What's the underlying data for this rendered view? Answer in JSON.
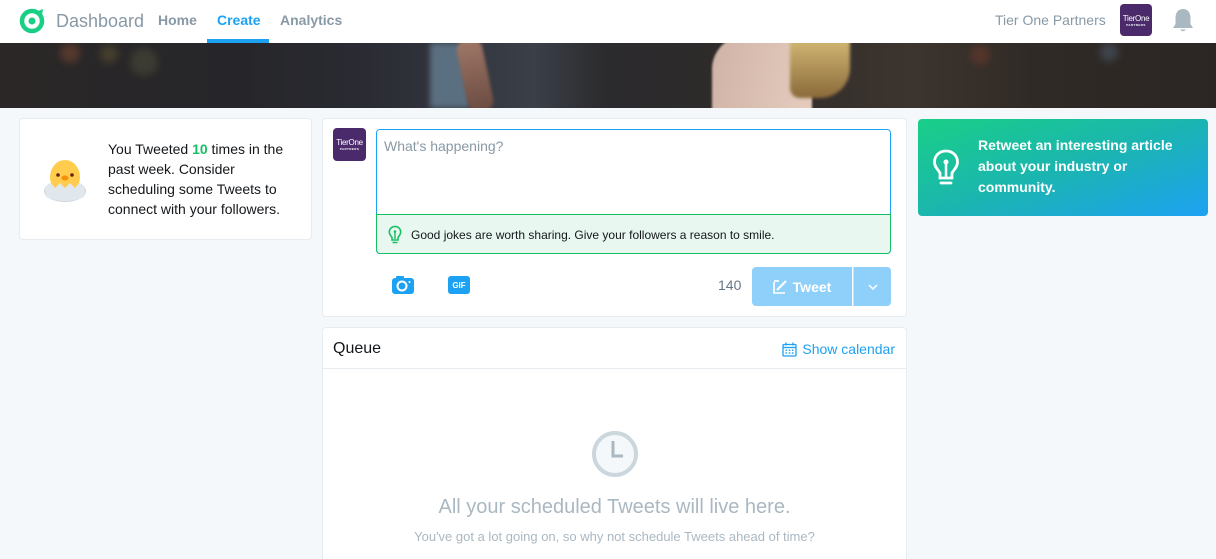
{
  "nav": {
    "brand": "Dashboard",
    "links": [
      {
        "label": "Home",
        "active": false
      },
      {
        "label": "Create",
        "active": true
      },
      {
        "label": "Analytics",
        "active": false
      }
    ],
    "account_name": "Tier One Partners",
    "avatar_text": "TierOne",
    "avatar_subtext": "PARTNERS",
    "icons": {
      "logo": "dashboard-logo-icon",
      "notifications": "bell-icon"
    }
  },
  "stats": {
    "prefix": "You Tweeted ",
    "count": "10",
    "suffix": " times in the past week. Consider scheduling some Tweets to connect with your followers.",
    "icon": "hatching-chick-icon"
  },
  "compose": {
    "placeholder": "What's happening?",
    "value": "",
    "tip": "Good jokes are worth sharing. Give your followers a reason to smile.",
    "char_count": "140",
    "tweet_label": "Tweet",
    "gif_label": "GIF",
    "icons": {
      "camera": "camera-icon",
      "gif": "gif-icon",
      "tip": "lightbulb-icon",
      "tweet": "compose-icon",
      "dropdown": "chevron-down-icon"
    }
  },
  "suggestion": {
    "text": "Retweet an interesting article about your industry or community.",
    "icon": "lightbulb-icon"
  },
  "queue": {
    "title": "Queue",
    "show_calendar": "Show calendar",
    "empty_title": "All your scheduled Tweets will live here.",
    "empty_subtitle": "You've got a lot going on, so why not schedule Tweets ahead of time?",
    "icons": {
      "calendar": "calendar-icon",
      "clock": "clock-icon"
    }
  },
  "colors": {
    "accent": "#1da1f2",
    "success": "#17bf63",
    "muted": "#8899a6",
    "background": "#f5f8fa",
    "avatar": "#4a2a6a"
  }
}
